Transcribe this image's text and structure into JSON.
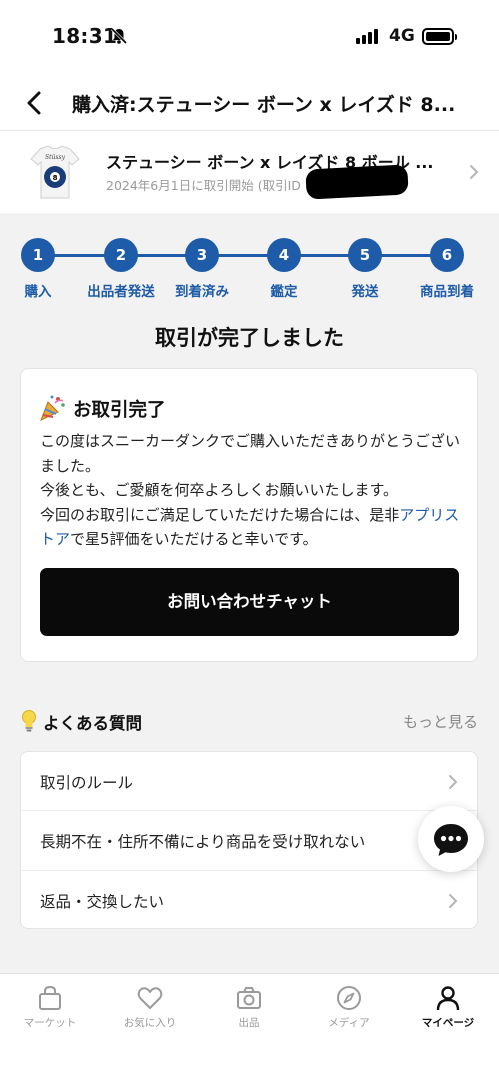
{
  "status_bar": {
    "time": "18:31",
    "network": "4G"
  },
  "header": {
    "title": "購入済:ステューシー ボーン x レイズド 8..."
  },
  "product": {
    "name": "ステューシー ボーン x レイズド 8 ボール ...",
    "date_text": "2024年6月1日に取引開始 (取引ID"
  },
  "steps": [
    {
      "number": "1",
      "label": "購入"
    },
    {
      "number": "2",
      "label": "出品者発送"
    },
    {
      "number": "3",
      "label": "到着済み"
    },
    {
      "number": "4",
      "label": "鑑定"
    },
    {
      "number": "5",
      "label": "発送"
    },
    {
      "number": "6",
      "label": "商品到着"
    }
  ],
  "completion_title": "取引が完了しました",
  "card": {
    "title": "お取引完了",
    "line1": "この度はスニーカーダンクでご購入いただきありがとうございました。",
    "line2": "今後とも、ご愛顧を何卒よろしくお願いいたします。",
    "line3_before": "今回のお取引にご満足していただけた場合には、是非",
    "line3_link": "アプリストア",
    "line3_after": "で星5評価をいただけると幸いです。",
    "button": "お問い合わせチャット"
  },
  "faq": {
    "title": "よくある質問",
    "more": "もっと見る",
    "items": [
      "取引のルール",
      "長期不在・住所不備により商品を受け取れない",
      "返品・交換したい"
    ]
  },
  "tabs": [
    "マーケット",
    "お気に入り",
    "出品",
    "メディア",
    "マイページ"
  ],
  "colors": {
    "accent": "#1e5ba8",
    "button": "#0a0a0a",
    "background": "#f2f2f2"
  }
}
